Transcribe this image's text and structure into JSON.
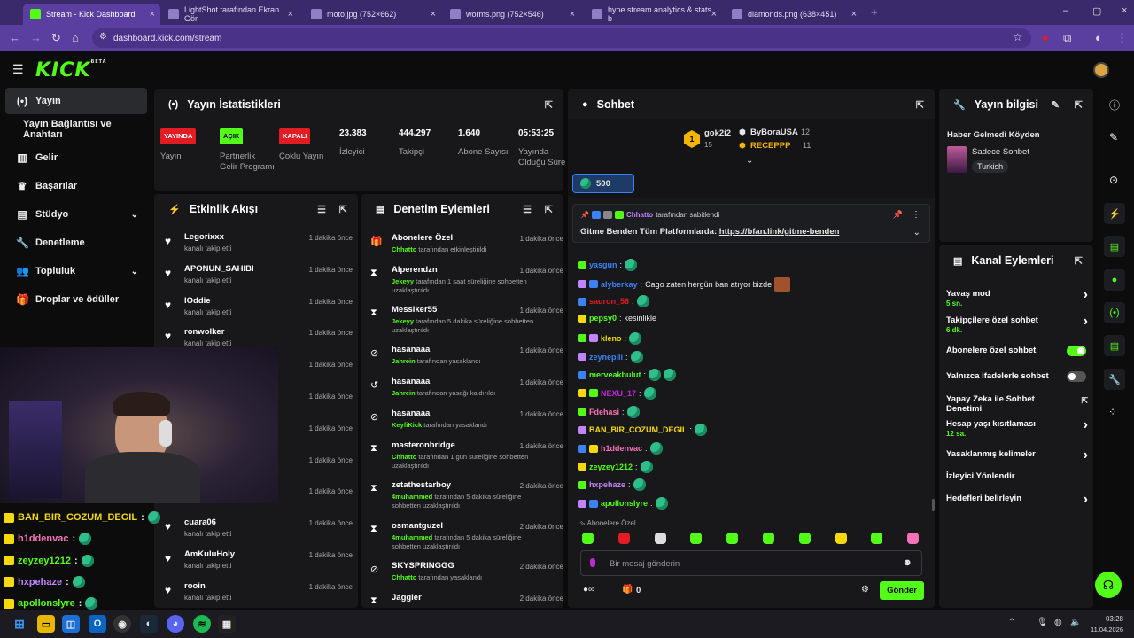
{
  "browser": {
    "tabs": [
      {
        "title": "Stream - Kick Dashboard",
        "active": true
      },
      {
        "title": "LightShot tarafından Ekran Gör"
      },
      {
        "title": "moto.jpg (752×662)"
      },
      {
        "title": "worms.png (752×546)"
      },
      {
        "title": "hype stream analytics & stats b"
      },
      {
        "title": "diamonds.png (638×451)"
      }
    ],
    "new_tab": "+",
    "url": "dashboard.kick.com/stream"
  },
  "brand": {
    "logo": "KICK",
    "logo_sup": "BETA",
    "accent": "#53fc18"
  },
  "sidebar": {
    "items": [
      {
        "label": "Yayın",
        "icon": "broadcast-icon",
        "active": true
      },
      {
        "label": "Yayın Bağlantısı ve Anahtarı",
        "icon": ""
      },
      {
        "label": "Gelir",
        "icon": "chart-icon"
      },
      {
        "label": "Başarılar",
        "icon": "trophy-icon"
      },
      {
        "label": "Stüdyo",
        "icon": "studio-icon"
      },
      {
        "label": "Denetleme",
        "icon": "wrench-icon"
      },
      {
        "label": "Topluluk",
        "icon": "users-icon"
      },
      {
        "label": "Droplar ve ödüller",
        "icon": "gift-icon"
      }
    ]
  },
  "stats": {
    "title": "Yayın İstatistikleri",
    "cells": [
      {
        "badge": "YAYINDA",
        "badge_color": "#e31b23",
        "label": "Yayın"
      },
      {
        "badge": "AÇIK",
        "badge_color": "#53fc18",
        "label": "Partnerlik Gelir Programı"
      },
      {
        "badge": "KAPALI",
        "badge_color": "#e31b23",
        "label": "Çoklu Yayın"
      },
      {
        "value": "23.383",
        "label": "İzleyici"
      },
      {
        "value": "444.297",
        "label": "Takipçi"
      },
      {
        "value": "1.640",
        "label": "Abone Sayısı"
      },
      {
        "value": "05:53:25",
        "label": "Yayında Olduğu Süre"
      }
    ]
  },
  "activity": {
    "title": "Etkinlik Akışı",
    "items": [
      {
        "name": "Legorixxx",
        "sub": "kanalı takip etti",
        "time": "1 dakika önce"
      },
      {
        "name": "APONUN_SAHIBI",
        "sub": "kanalı takip etti",
        "time": "1 dakika önce"
      },
      {
        "name": "lOddie",
        "sub": "kanalı takip etti",
        "time": "1 dakika önce"
      },
      {
        "name": "ronwolker",
        "sub": "kanalı takip etti",
        "time": "1 dakika önce"
      },
      {
        "name": "",
        "sub": "",
        "time": "1 dakika önce"
      },
      {
        "name": "",
        "sub": "",
        "time": "1 dakika önce"
      },
      {
        "name": "",
        "sub": "",
        "time": "1 dakika önce"
      },
      {
        "name": "",
        "sub": "",
        "time": "1 dakika önce"
      },
      {
        "name": "",
        "sub": "",
        "time": "1 dakika önce"
      },
      {
        "name": "cuara06",
        "sub": "kanalı takip etti",
        "time": "1 dakika önce"
      },
      {
        "name": "AmKuluHoly",
        "sub": "kanalı takip etti",
        "time": "1 dakika önce"
      },
      {
        "name": "rooin",
        "sub": "kanalı takip etti",
        "time": "1 dakika önce"
      }
    ]
  },
  "moderation": {
    "title": "Denetim Eylemleri",
    "items": [
      {
        "icon": "gift-icon",
        "name": "Abonelere Özel",
        "by": "Chhatto",
        "rest": " tarafından etkinleştirildi",
        "time": "1 dakika önce"
      },
      {
        "icon": "hourglass-icon",
        "name": "Alperendzn",
        "by": "Jekeyy",
        "rest": " tarafından 1 saat süreliğine sohbetten uzaklaştırıldı",
        "time": "1 dakika önce"
      },
      {
        "icon": "hourglass-icon",
        "name": "Messiker55",
        "by": "Jekeyy",
        "rest": " tarafından 5 dakika süreliğine sohbetten uzaklaştırıldı",
        "time": "1 dakika önce"
      },
      {
        "icon": "ban-icon",
        "name": "hasanaaa",
        "by": "Jahrein",
        "rest": " tarafından yasaklandı",
        "time": "1 dakika önce"
      },
      {
        "icon": "undo-icon",
        "name": "hasanaaa",
        "by": "Jahrein",
        "rest": " tarafından yasağı kaldırıldı",
        "time": "1 dakika önce"
      },
      {
        "icon": "ban-icon",
        "name": "hasanaaa",
        "by": "KeyfiKick",
        "rest": " tarafından yasaklandı",
        "time": "1 dakika önce"
      },
      {
        "icon": "hourglass-icon",
        "name": "masteronbridge",
        "by": "Chhatto",
        "rest": " tarafından 1 gün süreliğine sohbetten uzaklaştırıldı",
        "time": "1 dakika önce"
      },
      {
        "icon": "hourglass-icon",
        "name": "zetathestarboy",
        "by": "4muhammed",
        "rest": " tarafından 5 dakika süreliğine sohbetten uzaklaştırıldı",
        "time": "2 dakika önce"
      },
      {
        "icon": "hourglass-icon",
        "name": "osmantguzel",
        "by": "4muhammed",
        "rest": " tarafından 5 dakika süreliğine sohbetten uzaklaştırıldı",
        "time": "2 dakika önce"
      },
      {
        "icon": "ban-icon",
        "name": "SKYSPRINGGG",
        "by": "Chhatto",
        "rest": " tarafından yasaklandı",
        "time": "2 dakika önce"
      },
      {
        "icon": "hourglass-icon",
        "name": "Jaggler",
        "by": "",
        "rest": "",
        "time": "2 dakika önce"
      }
    ]
  },
  "chat": {
    "title": "Sohbet",
    "leaderboard": [
      {
        "rank": "1",
        "name": "gok2i2",
        "count": "15"
      },
      {
        "name": "ByBoraUSA",
        "count": "12"
      },
      {
        "name": "RECEPPP",
        "count": "11"
      }
    ],
    "kicks": "500",
    "pinned": {
      "by": "Chhatto",
      "by_suffix": " tarafından sabitlendi",
      "text": "Gitme Benden Tüm Platformlarda: ",
      "link": "https://bfan.link/gitme-benden"
    },
    "messages": [
      {
        "user": "yasgun",
        "color": "#3b82f6",
        "text": "",
        "emotes": 1
      },
      {
        "user": "alyberkay",
        "color": "#3b82f6",
        "text": " Cago zaten hergün ban atıyor bizde",
        "emotes": 0,
        "img": true
      },
      {
        "user": "sauron_56",
        "color": "#e31b23",
        "text": "",
        "emotes": 1
      },
      {
        "user": "pepsy0",
        "color": "#53fc18",
        "text": " kesinlikle",
        "emotes": 0
      },
      {
        "user": "kleno",
        "color": "#f5d90a",
        "text": "",
        "emotes": 1
      },
      {
        "user": "zeynepili",
        "color": "#3b82f6",
        "text": "",
        "emotes": 1
      },
      {
        "user": "merveakbulut",
        "color": "#53fc18",
        "text": "",
        "emotes": 2
      },
      {
        "user": "NEXU_17",
        "color": "#c026d3",
        "text": "",
        "emotes": 1
      },
      {
        "user": "Fdehasi",
        "color": "#f472b6",
        "text": "",
        "emotes": 1
      },
      {
        "user": "BAN_BIR_COZUM_DEGIL",
        "color": "#f5d90a",
        "text": "",
        "emotes": 1
      },
      {
        "user": "h1ddenvac",
        "color": "#f472b6",
        "text": "",
        "emotes": 1
      },
      {
        "user": "zeyzey1212",
        "color": "#53fc18",
        "text": "",
        "emotes": 1
      },
      {
        "user": "hxpehaze",
        "color": "#c084fc",
        "text": "",
        "emotes": 1
      },
      {
        "user": "apollonslyre",
        "color": "#53fc18",
        "text": "",
        "emotes": 1
      }
    ],
    "mode_label": "Abonelere Özel",
    "input_placeholder": "Bir mesaj gönderin",
    "gift_count": "0",
    "send_label": "Gönder"
  },
  "stream_info": {
    "title": "Yayın bilgisi",
    "stream_title": "Haber Gelmedi Köyden",
    "category": "Sadece Sohbet",
    "tag": "Turkish"
  },
  "channel_actions": {
    "title": "Kanal Eylemleri",
    "rows": [
      {
        "label": "Yavaş mod",
        "sub": "5 sn.",
        "kind": "chevron"
      },
      {
        "label": "Takipçilere özel sohbet",
        "sub": "6 dk.",
        "kind": "chevron"
      },
      {
        "label": "Abonelere özel sohbet",
        "kind": "toggle",
        "on": true
      },
      {
        "label": "Yalnızca ifadelerle sohbet",
        "kind": "toggle",
        "on": false
      },
      {
        "label": "Yapay Zeka ile Sohbet Denetimi",
        "kind": "external"
      },
      {
        "label": "Hesap yaşı kısıtlaması",
        "sub": "12 sa.",
        "kind": "chevron"
      },
      {
        "label": "Yasaklanmış kelimeler",
        "kind": "chevron"
      },
      {
        "label": "İzleyici Yönlendir",
        "kind": "none"
      },
      {
        "label": "Hedefleri belirleyin",
        "kind": "chevron"
      }
    ]
  },
  "overlay_chat": [
    {
      "user": "BAN_BIR_COZUM_DEGIL",
      "color": "#f5d90a"
    },
    {
      "user": "h1ddenvac",
      "color": "#f472b6"
    },
    {
      "user": "zeyzey1212",
      "color": "#53fc18"
    },
    {
      "user": "hxpehaze",
      "color": "#c084fc"
    },
    {
      "user": "apollonslyre",
      "color": "#53fc18"
    }
  ],
  "taskbar": {
    "time": "03:28",
    "date": "11.04.2026"
  }
}
